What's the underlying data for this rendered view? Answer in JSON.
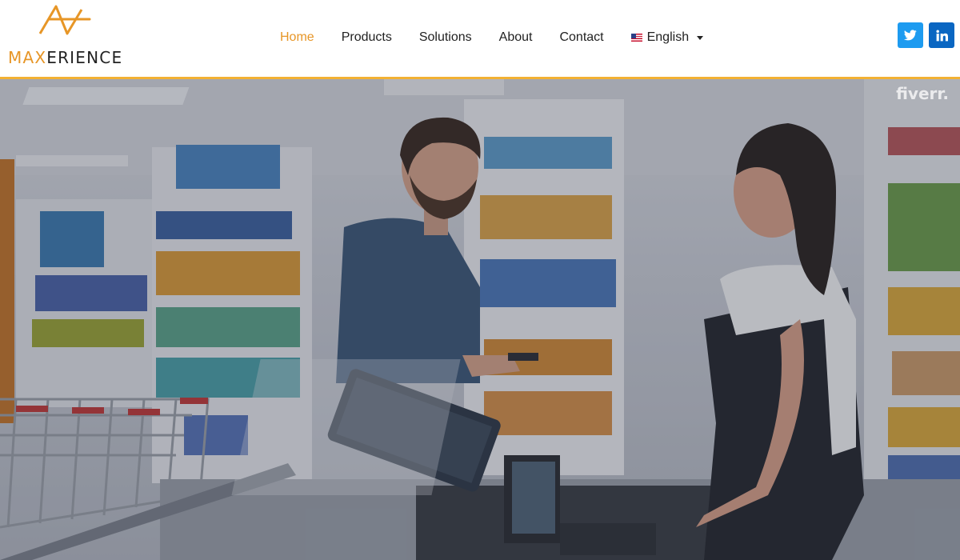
{
  "brand": {
    "logo_text_accent": "MAX",
    "logo_text_rest": "ERIENCE",
    "accent_color": "#e79627"
  },
  "nav": {
    "items": [
      {
        "label": "Home",
        "active": true
      },
      {
        "label": "Products",
        "active": false
      },
      {
        "label": "Solutions",
        "active": false
      },
      {
        "label": "About",
        "active": false
      },
      {
        "label": "Contact",
        "active": false
      }
    ],
    "language": {
      "label": "English",
      "flag": "us-flag-icon"
    }
  },
  "social": [
    {
      "name": "twitter-icon",
      "color": "#1d9bf0"
    },
    {
      "name": "linkedin-icon",
      "color": "#0a66c2"
    }
  ],
  "hero": {
    "watermark": "fiverr."
  }
}
